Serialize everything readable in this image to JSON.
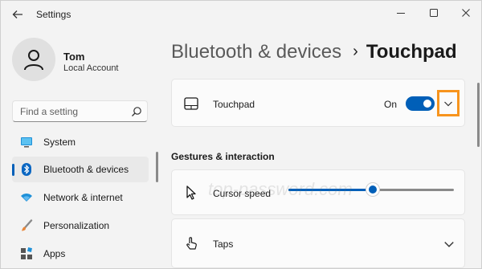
{
  "window": {
    "title": "Settings",
    "controls": [
      "minimize-icon",
      "maximize-icon",
      "close-icon"
    ]
  },
  "user": {
    "name": "Tom",
    "account": "Local Account"
  },
  "search": {
    "placeholder": "Find a setting"
  },
  "sidebar": {
    "items": [
      {
        "label": "System",
        "icon": "system-icon",
        "active": false
      },
      {
        "label": "Bluetooth & devices",
        "icon": "bluetooth-icon",
        "active": true
      },
      {
        "label": "Network & internet",
        "icon": "wifi-icon",
        "active": false
      },
      {
        "label": "Personalization",
        "icon": "brush-icon",
        "active": false
      },
      {
        "label": "Apps",
        "icon": "apps-icon",
        "active": false
      }
    ]
  },
  "breadcrumb": {
    "parent": "Bluetooth & devices",
    "separator": "›",
    "current": "Touchpad"
  },
  "touchpad_card": {
    "label": "Touchpad",
    "state": "On",
    "on": true
  },
  "section": {
    "heading": "Gestures & interaction"
  },
  "cursor_speed": {
    "label": "Cursor speed",
    "level_fraction": 0.51
  },
  "taps": {
    "label": "Taps"
  },
  "watermark": "top-password.com",
  "colors": {
    "accent": "#005fb8",
    "highlight": "#f7941d",
    "background": "#f3f3f3",
    "card": "#fbfbfb"
  }
}
